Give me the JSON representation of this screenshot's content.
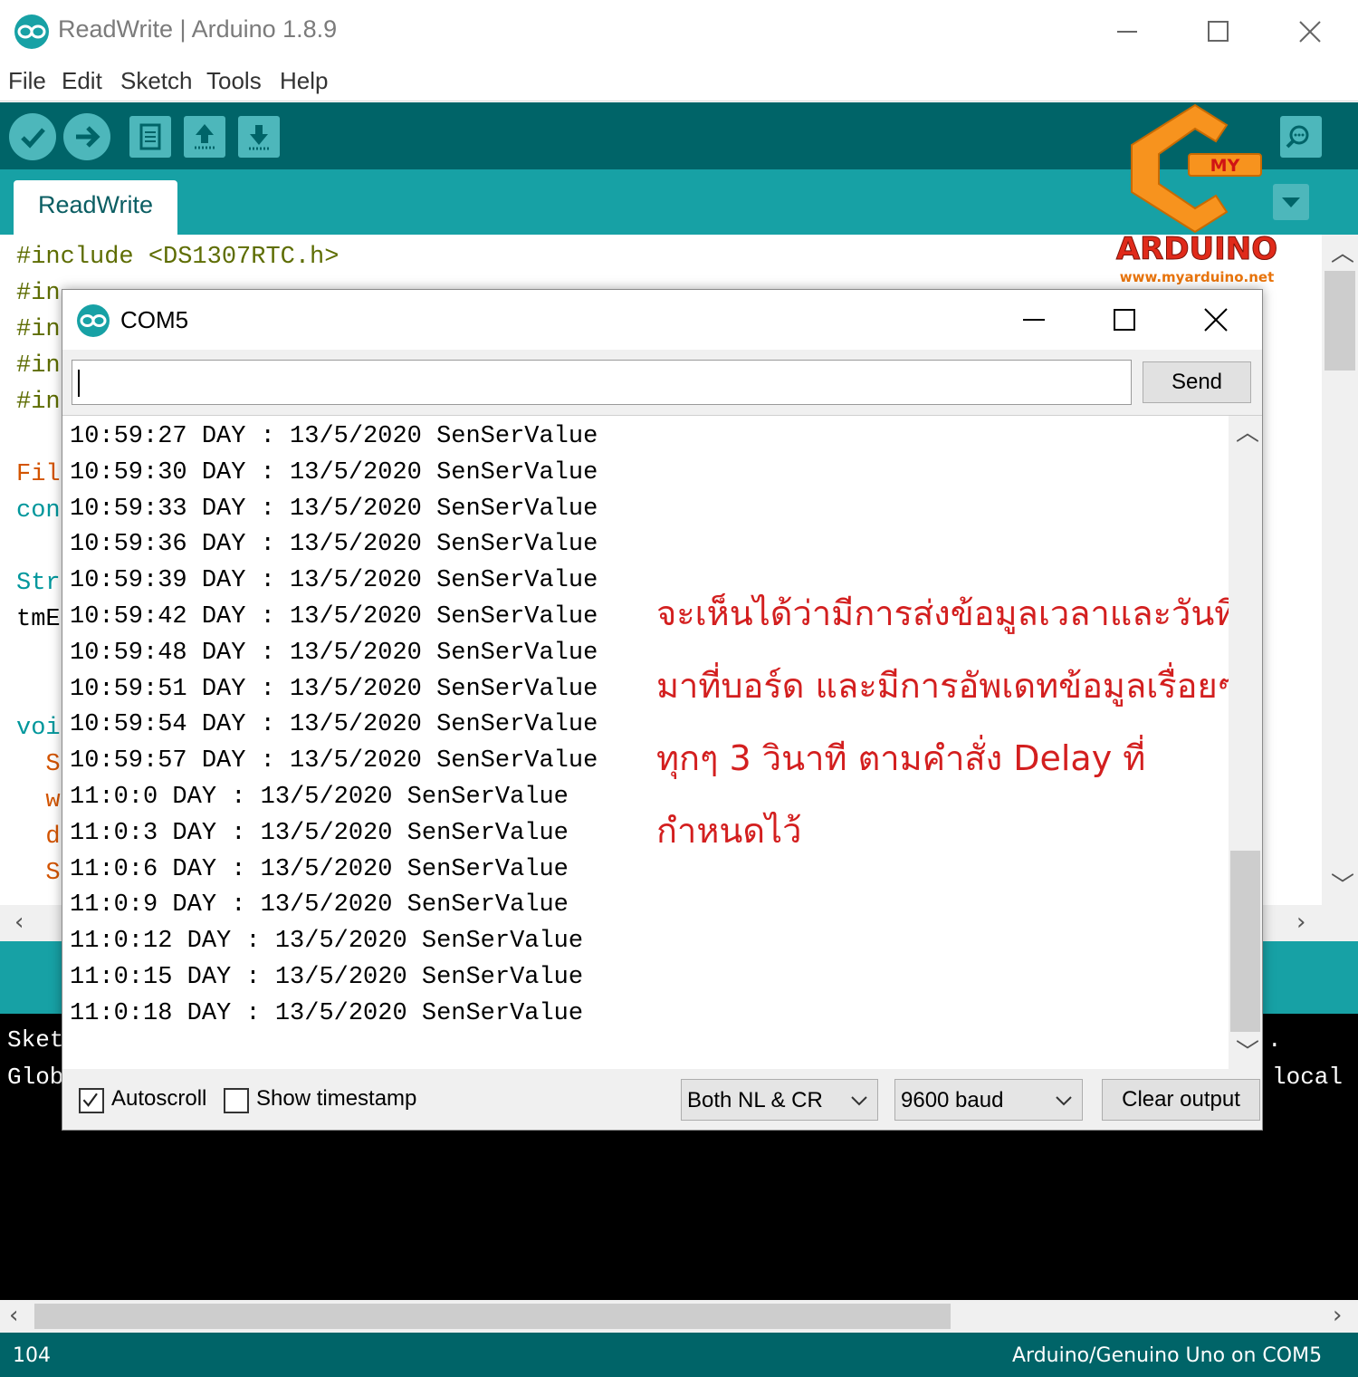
{
  "window": {
    "title": "ReadWrite | Arduino 1.8.9"
  },
  "menu": [
    "File",
    "Edit",
    "Sketch",
    "Tools",
    "Help"
  ],
  "toolbar": {
    "buttons": [
      "verify-icon",
      "upload-icon",
      "new-icon",
      "open-icon",
      "save-icon",
      "serial-monitor-icon"
    ]
  },
  "tab": {
    "label": "ReadWrite"
  },
  "editor": {
    "lines": [
      {
        "text": "#include <DS1307RTC.h>",
        "color": "#5e6d03"
      },
      {
        "text": "#in",
        "color": "#5e6d03"
      },
      {
        "text": "#in",
        "color": "#5e6d03"
      },
      {
        "text": "#in",
        "color": "#5e6d03"
      },
      {
        "text": "#in",
        "color": "#5e6d03"
      },
      {
        "text": "",
        "color": "#000000"
      },
      {
        "text": "Fil",
        "color": "#d35400"
      },
      {
        "text": "con",
        "color": "#00979c"
      },
      {
        "text": "",
        "color": "#000000"
      },
      {
        "text": "Str",
        "color": "#00979c"
      },
      {
        "text": "tmE",
        "color": "#000000"
      },
      {
        "text": "",
        "color": "#000000"
      },
      {
        "text": "",
        "color": "#000000"
      },
      {
        "text": "voi",
        "color": "#00979c"
      },
      {
        "text": "  S",
        "color": "#d35400"
      },
      {
        "text": "  w",
        "color": "#d35400"
      },
      {
        "text": "  d",
        "color": "#d35400"
      },
      {
        "text": "  S",
        "color": "#d35400"
      }
    ]
  },
  "console": {
    "lines": [
      "Sket",
      "Glob"
    ],
    "right_fragment_1": ".",
    "right_fragment_2": "local"
  },
  "status": {
    "line": "104",
    "board": "Arduino/Genuino Uno on COM5"
  },
  "brand": {
    "text": "ARDUINO",
    "url": "www.myarduino.net",
    "badge": "MY"
  },
  "serial_monitor": {
    "title": "COM5",
    "input_value": "",
    "send_label": "Send",
    "output_lines": [
      "10:59:27 DAY : 13/5/2020 SenSerValue",
      "10:59:30 DAY : 13/5/2020 SenSerValue",
      "10:59:33 DAY : 13/5/2020 SenSerValue",
      "10:59:36 DAY : 13/5/2020 SenSerValue",
      "10:59:39 DAY : 13/5/2020 SenSerValue",
      "10:59:42 DAY : 13/5/2020 SenSerValue",
      "10:59:48 DAY : 13/5/2020 SenSerValue",
      "10:59:51 DAY : 13/5/2020 SenSerValue",
      "10:59:54 DAY : 13/5/2020 SenSerValue",
      "10:59:57 DAY : 13/5/2020 SenSerValue",
      "11:0:0 DAY : 13/5/2020 SenSerValue",
      "11:0:3 DAY : 13/5/2020 SenSerValue",
      "11:0:6 DAY : 13/5/2020 SenSerValue",
      "11:0:9 DAY : 13/5/2020 SenSerValue",
      "11:0:12 DAY : 13/5/2020 SenSerValue",
      "11:0:15 DAY : 13/5/2020 SenSerValue",
      "11:0:18 DAY : 13/5/2020 SenSerValue"
    ],
    "annotation": [
      "จะเห็นได้ว่ามีการส่งข้อมูลเวลาและวันที่",
      "มาที่บอร์ด และมีการอัพเดทข้อมูลเรื่อยๆ",
      "ทุกๆ 3 วินาที ตามคำสั่ง Delay ที่",
      "กำหนดไว้"
    ],
    "autoscroll_label": "Autoscroll",
    "autoscroll_checked": true,
    "timestamp_label": "Show timestamp",
    "timestamp_checked": false,
    "line_ending": "Both NL & CR",
    "baud": "9600 baud",
    "clear_label": "Clear output"
  },
  "colors": {
    "teal_dark": "#006468",
    "teal": "#17A1A5",
    "annotation_red": "#d31f1f",
    "brand_orange": "#f7931e"
  }
}
